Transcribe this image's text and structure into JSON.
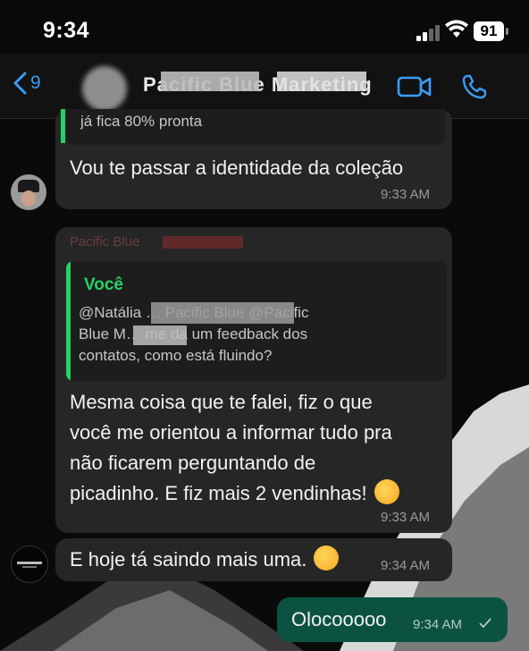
{
  "status_bar": {
    "time": "9:34",
    "battery": "91"
  },
  "header": {
    "back_count": "9",
    "contact_name": "Pacific Blue Marketing",
    "video_icon": "video-camera-icon",
    "call_icon": "phone-icon"
  },
  "messages": {
    "cut_off_text": "já fica 80% pronta",
    "msg1": {
      "text": "Vou te passar a identidade da coleção",
      "time": "9:33 AM"
    },
    "msg2": {
      "sender": "Pacific Blue",
      "quote_name": "Você",
      "quote_line1": "@Natália …  Pacific Blue @Pacific",
      "quote_line2": "Blue M…      me da um feedback dos",
      "quote_line3": "contatos, como está fluindo?",
      "line1": "Mesma coisa que te falei, fiz o que",
      "line2": "você me orientou a informar tudo pra",
      "line3": "não ficarem perguntando de",
      "line4": "picadinho. E fiz mais 2 vendinhas!",
      "time": "9:33 AM"
    },
    "msg3": {
      "text": "E hoje tá saindo mais uma.",
      "time": "9:34 AM"
    },
    "msg4": {
      "text": "Olocooooo",
      "time": "9:34 AM"
    }
  }
}
